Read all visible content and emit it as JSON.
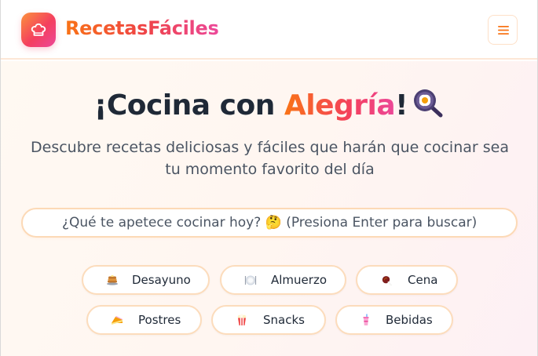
{
  "brand": {
    "name": "RecetasFáciles",
    "icon": "chef-hat-icon"
  },
  "header": {
    "menu_icon": "hamburger-menu-icon"
  },
  "hero": {
    "title_prefix": "¡Cocina con ",
    "title_accent": "Alegría",
    "title_suffix": "!",
    "title_icon": "frying-pan-egg-icon",
    "subtitle": "Descubre recetas deliciosas y fáciles que harán que cocinar sea tu momento favorito del día"
  },
  "search": {
    "placeholder": "¿Qué te apetece cocinar hoy? 🤔 (Presiona Enter para buscar)",
    "value": ""
  },
  "categories": [
    {
      "label": "Desayuno",
      "icon": "pancakes-icon"
    },
    {
      "label": "Almuerzo",
      "icon": "plate-icon"
    },
    {
      "label": "Cena",
      "icon": "meat-icon"
    },
    {
      "label": "Postres",
      "icon": "cake-icon"
    },
    {
      "label": "Snacks",
      "icon": "popcorn-icon"
    },
    {
      "label": "Bebidas",
      "icon": "drink-icon"
    }
  ],
  "colors": {
    "brand_orange": "#f97316",
    "brand_pink": "#ec4899",
    "text_dark": "#1f2937",
    "text_muted": "#4b5563",
    "border_peach": "#fcd9b6"
  }
}
